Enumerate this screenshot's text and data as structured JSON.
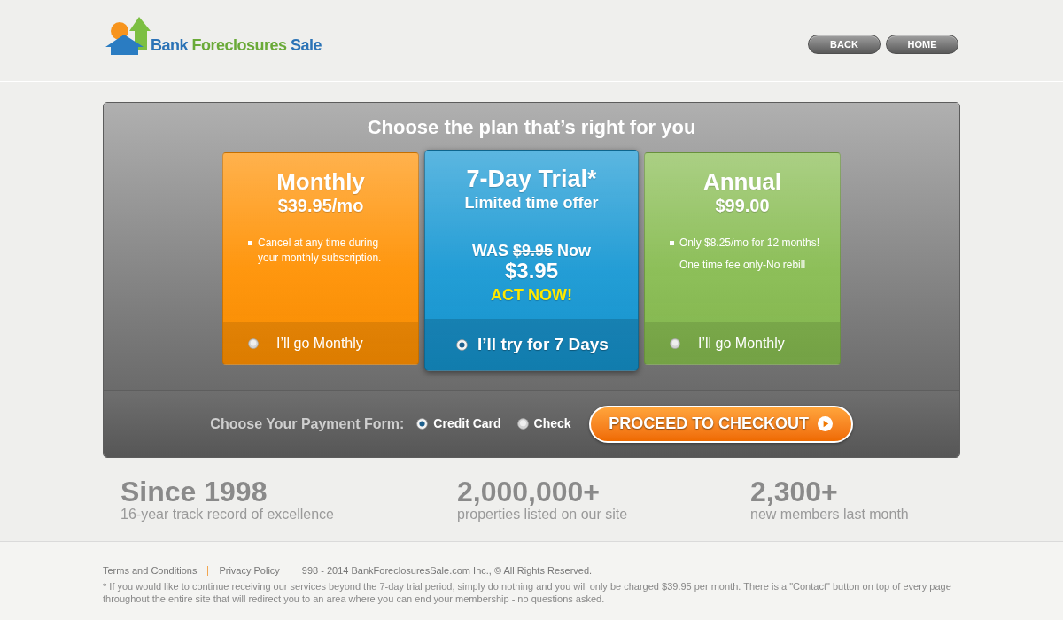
{
  "header": {
    "logo": {
      "words": [
        {
          "text": "Bank",
          "color": "#2b73b6"
        },
        {
          "text": "Foreclosures",
          "color": "#6aaa38"
        },
        {
          "text": "Sale",
          "color": "#2b73b6"
        }
      ]
    },
    "buttons": [
      {
        "label": "BACK"
      },
      {
        "label": "HOME"
      }
    ]
  },
  "plans_panel": {
    "title": "Choose the plan that’s right for you",
    "plans": [
      {
        "kind": "standard",
        "color": "#ff9000",
        "name": "Monthly",
        "price": "$39.95/mo",
        "features": [
          {
            "text": "Cancel at any time during your monthly subscription.",
            "bullet": true
          }
        ],
        "option": "I’ll go Monthly",
        "selected": false
      },
      {
        "kind": "offer",
        "color": "#1597d3",
        "name": "7-Day Trial*",
        "subtitle": "Limited time offer",
        "was_label": "WAS",
        "old_price": "$9.95",
        "now_label": "Now",
        "price": "$3.95",
        "call_to_action": "ACT NOW!",
        "option": "I’ll try for 7 Days",
        "selected": true
      },
      {
        "kind": "standard",
        "color": "#86bb4f",
        "name": "Annual",
        "price": "$99.00",
        "features": [
          {
            "text": "Only $8.25/mo for 12 months!",
            "bullet": true
          },
          {
            "text": "One time fee only-No rebill",
            "bullet": false
          }
        ],
        "option": "I’ll go Monthly",
        "selected": false
      }
    ]
  },
  "payment": {
    "label": "Choose Your Payment Form:",
    "options": [
      {
        "label": "Credit Card",
        "selected": true
      },
      {
        "label": "Check",
        "selected": false
      }
    ],
    "checkout_button": "PROCEED TO CHECKOUT"
  },
  "stats": [
    {
      "value": "Since 1998",
      "caption": "16-year track record of excellence"
    },
    {
      "value": "2,000,000+",
      "caption": "properties listed on our site"
    },
    {
      "value": "2,300+",
      "caption": "new members last month"
    }
  ],
  "footer": {
    "links": [
      "Terms and Conditions",
      "Privacy Policy"
    ],
    "copyright": "998 - 2014 BankForeclosuresSale.com Inc., © All Rights Reserved.",
    "note": "* If you would like to continue receiving our services beyond the 7-day trial period, simply do nothing and you will only be charged $39.95 per month. There is a \"Contact\" button on top of every page throughout the entire site that will redirect you to an area where you can end your membership - no questions asked."
  }
}
